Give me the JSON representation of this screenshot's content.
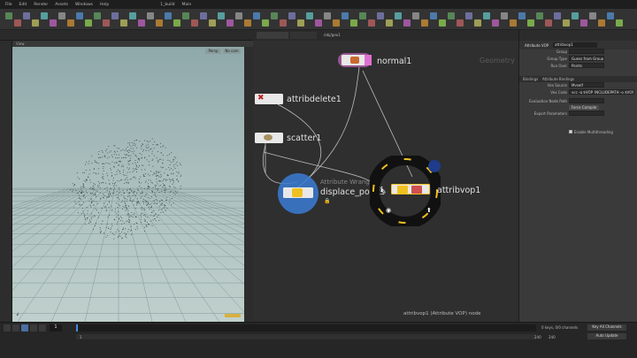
{
  "menubar": {
    "items": [
      "File",
      "Edit",
      "Render",
      "Assets",
      "Windows",
      "Help"
    ],
    "build_label": "1_build",
    "main_label": "Main"
  },
  "viewport": {
    "header_label": "View",
    "persp_label": "Persp",
    "cam_label": "No cam"
  },
  "network": {
    "path_label": "/obj/geo1",
    "context_label": "Geometry",
    "status_text": "attribvop1 (Attribute VOP) node",
    "nodes": [
      {
        "label": "normal1"
      },
      {
        "label": "attribdelete1"
      },
      {
        "label": "scatter1"
      },
      {
        "label": "displace_points",
        "type_label": "Attribute Wrangle"
      },
      {
        "label": "attribvop1"
      }
    ]
  },
  "params": {
    "node_type": "Attribute VOP",
    "node_name": "attribvop1",
    "tabs": [
      "Bindings",
      "Attribute Bindings"
    ],
    "rows": [
      {
        "label": "Group"
      },
      {
        "label": "Group Type",
        "value": "Guess from Group"
      },
      {
        "label": "Run Over",
        "value": "Points"
      },
      {
        "label": "Vex Source",
        "value": "Myself"
      },
      {
        "label": "Vex Code",
        "value": "vcc -q $VOP_INCLUDEPATH -o $VOP"
      },
      {
        "label": "Evaluation Node Path"
      },
      {
        "label": "Export Parameters"
      }
    ],
    "force_compile_label": "Force Compile",
    "multithread_label": "Enable Multithreading"
  },
  "timeline": {
    "frame": "1",
    "start": "1",
    "end": "240",
    "end2": "240",
    "keys_label": "0 keys, 0/0 channels",
    "key_all_label": "Key All Channels",
    "auto_update_label": "Auto Update"
  },
  "colors": {
    "accent": "#f0c020",
    "node_pink": "#e070d0",
    "wrangle_blue": "#3a7bd5",
    "bg_net": "#2f2f2f"
  }
}
